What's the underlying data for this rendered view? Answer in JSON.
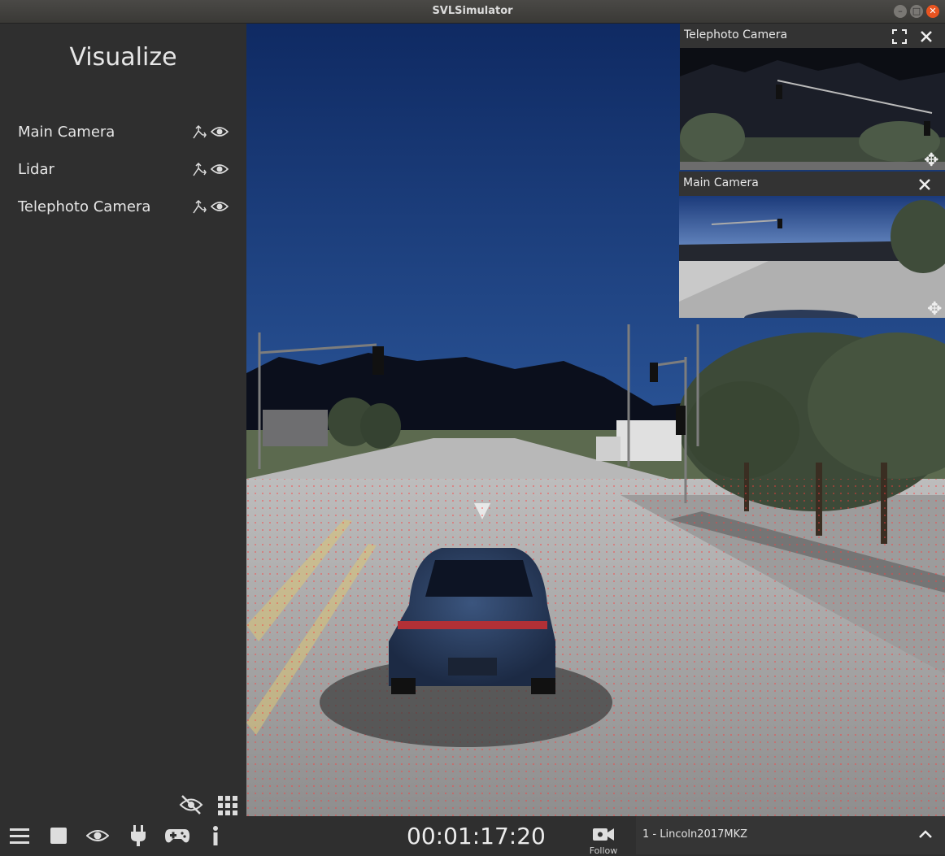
{
  "window": {
    "title": "SVLSimulator"
  },
  "sidebar": {
    "heading": "Visualize",
    "items": [
      {
        "label": "Main Camera"
      },
      {
        "label": "Lidar"
      },
      {
        "label": "Telephoto Camera"
      }
    ]
  },
  "sensor_windows": [
    {
      "title": "Telephoto Camera"
    },
    {
      "title": "Main Camera"
    }
  ],
  "bottombar": {
    "timer": "00:01:17:20",
    "follow_label": "Follow",
    "agent": "1 - Lincoln2017MKZ"
  },
  "colors": {
    "accent_close": "#e95420",
    "panel": "#2f2f2f",
    "lidar": "#ff3b3b"
  }
}
